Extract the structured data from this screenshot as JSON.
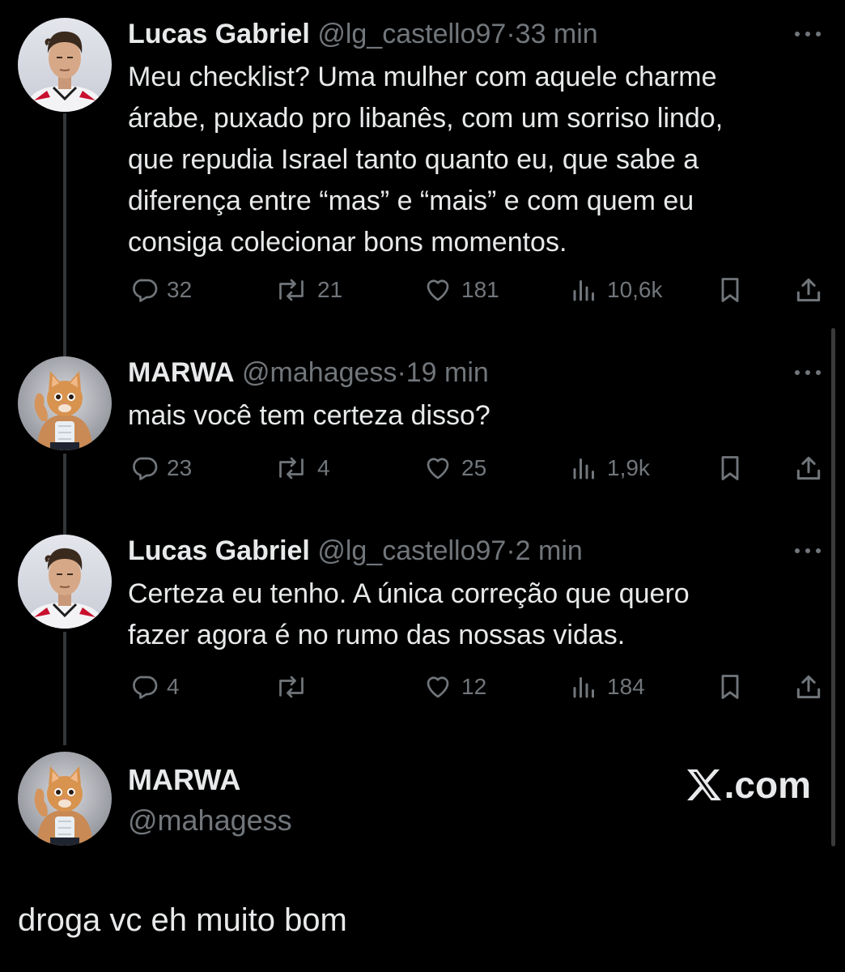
{
  "colors": {
    "background": "#000000",
    "primary_text": "#e7e9ea",
    "secondary_text": "#71767b",
    "thread_line": "#333639"
  },
  "tweets": [
    {
      "name": "Lucas Gabriel",
      "handle": "@lg_castello97",
      "separator": "·",
      "time": "33 min",
      "lines": [
        "Meu checklist? Uma mulher com aquele charme",
        "árabe, puxado pro libanês, com um sorriso lindo,",
        "que repudia Israel tanto quanto eu, que sabe a",
        "diferença entre “mas” e “mais” e com quem eu",
        "consiga colecionar bons momentos."
      ],
      "replies": "32",
      "reposts": "21",
      "likes": "181",
      "views": "10,6k",
      "avatar_icon": "soccer-player-avatar"
    },
    {
      "name": "MARWA",
      "handle": "@mahagess",
      "separator": "·",
      "time": "19 min",
      "lines": [
        "mais você tem certeza disso?"
      ],
      "replies": "23",
      "reposts": "4",
      "likes": "25",
      "views": "1,9k",
      "avatar_icon": "muscular-cat-avatar"
    },
    {
      "name": "Lucas Gabriel",
      "handle": "@lg_castello97",
      "separator": "·",
      "time": "2 min",
      "lines": [
        "Certeza eu tenho. A única correção que quero",
        "fazer agora é no rumo das nossas vidas."
      ],
      "replies": "4",
      "reposts": "",
      "likes": "12",
      "views": "184",
      "avatar_icon": "soccer-player-avatar"
    }
  ],
  "watermark": {
    "name": "MARWA",
    "handle": "@mahagess",
    "brand_suffix": ".com",
    "brand_icon": "x-logo-icon"
  },
  "caption": "droga vc eh muito bom",
  "icons": {
    "reply": "reply-icon",
    "repost": "repost-icon",
    "like": "like-icon",
    "views": "views-icon",
    "bookmark": "bookmark-icon",
    "share": "share-icon",
    "more": "more-options-icon"
  }
}
